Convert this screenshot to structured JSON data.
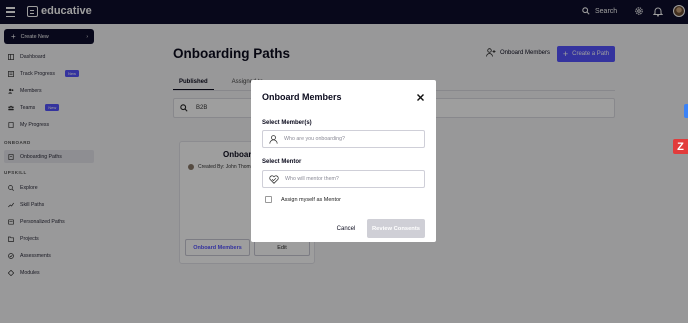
{
  "app": {
    "name": "educative"
  },
  "topbar": {
    "search_label": "Search"
  },
  "sidebar": {
    "create_label": "Create New",
    "items": [
      {
        "label": "Dashboard",
        "icon": "dashboard-icon"
      },
      {
        "label": "Track Progress",
        "badge": "New",
        "icon": "track-progress-icon"
      },
      {
        "label": "Members",
        "icon": "members-icon"
      },
      {
        "label": "Teams",
        "badge": "New",
        "icon": "teams-icon"
      },
      {
        "label": "My Progress",
        "icon": "my-progress-icon"
      }
    ],
    "section_onboard": "ONBOARD",
    "onboard_items": [
      {
        "label": "Onboarding Paths",
        "icon": "onboarding-paths-icon",
        "active": true
      }
    ],
    "section_upskill": "UPSKILL",
    "upskill_items": [
      {
        "label": "Explore",
        "icon": "explore-icon"
      },
      {
        "label": "Skill Paths",
        "icon": "skill-paths-icon"
      },
      {
        "label": "Personalized Paths",
        "icon": "personalized-paths-icon"
      },
      {
        "label": "Projects",
        "icon": "projects-icon"
      },
      {
        "label": "Assessments",
        "icon": "assessments-icon"
      },
      {
        "label": "Modules",
        "icon": "modules-icon"
      }
    ]
  },
  "main": {
    "title": "Onboarding Paths",
    "onboard_members_label": "Onboard Members",
    "create_path_label": "Create a Path",
    "tabs": [
      {
        "label": "Published",
        "active": true
      },
      {
        "label": "Assigned to"
      }
    ],
    "search_value": "B2B",
    "card": {
      "title": "Onboar",
      "creator": "Created By: John Thom",
      "primary_button": "Onboard Members",
      "secondary_button": "Edit"
    }
  },
  "modal": {
    "title": "Onboard Members",
    "members_label": "Select Member(s)",
    "members_placeholder": "Who are you onboarding?",
    "mentor_label": "Select Mentor",
    "mentor_placeholder": "Who will mentor them?",
    "assign_self_label": "Assign myself as Mentor",
    "cancel_label": "Cancel",
    "review_label": "Review Consents"
  },
  "colors": {
    "navy": "#0e0e2c",
    "accent": "#5553ff",
    "zendesk": "#e23b3b"
  }
}
